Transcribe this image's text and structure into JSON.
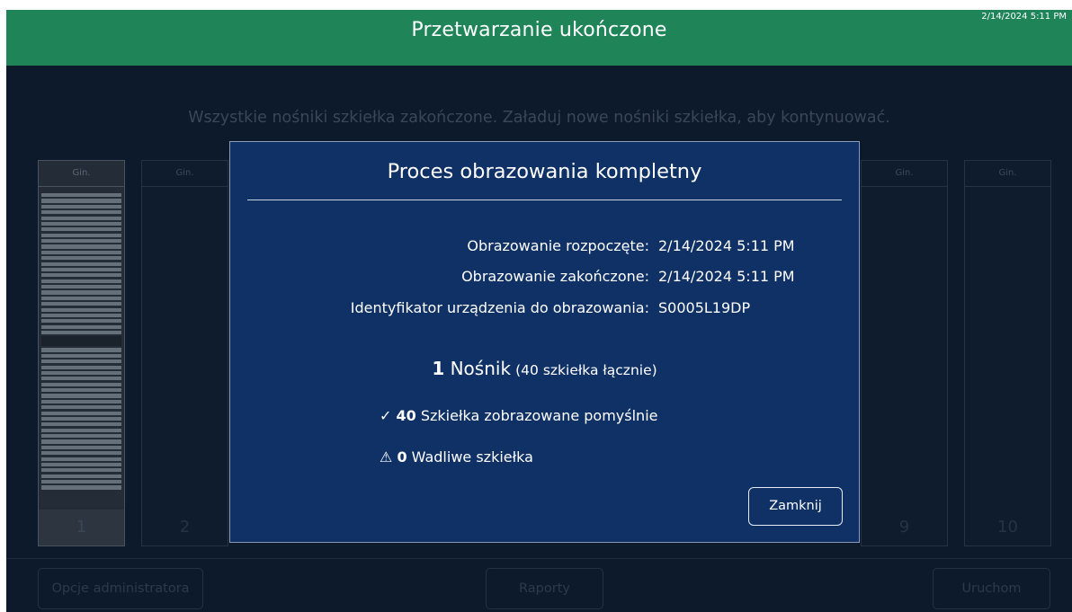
{
  "header": {
    "title": "Przetwarzanie ukończone",
    "timestamp": "2/14/2024 5:11 PM"
  },
  "instruction": "Wszystkie nośniki szkiełka zakończone. Załaduj nowe nośniki szkiełka, aby kontynuować.",
  "slots": [
    {
      "head": "Gin.",
      "number": "1"
    },
    {
      "head": "Gin.",
      "number": "2"
    },
    {
      "head": "Gin.",
      "number": "9"
    },
    {
      "head": "Gin.",
      "number": "10"
    }
  ],
  "bottom_bar": {
    "admin_label": "Opcje administratora",
    "reports_label": "Raporty",
    "run_label": "Uruchom"
  },
  "dialog": {
    "title": "Proces obrazowania kompletny",
    "fields": [
      {
        "label": "Obrazowanie rozpoczęte:",
        "value": "2/14/2024 5:11 PM"
      },
      {
        "label": "Obrazowanie zakończone:",
        "value": "2/14/2024 5:11 PM"
      },
      {
        "label": "Identyfikator urządzenia do obrazowania:",
        "value": "S0005L19DP"
      }
    ],
    "carrier": {
      "count": "1",
      "label": "Nośnik",
      "detail": "(40 szkiełka łącznie)"
    },
    "success": {
      "icon": "checkmark-icon",
      "count": "40",
      "label": "Szkiełka zobrazowane pomyślnie"
    },
    "defective": {
      "icon": "warning-icon",
      "count": "0",
      "label": "Wadliwe szkiełka"
    },
    "close_label": "Zamknij"
  }
}
